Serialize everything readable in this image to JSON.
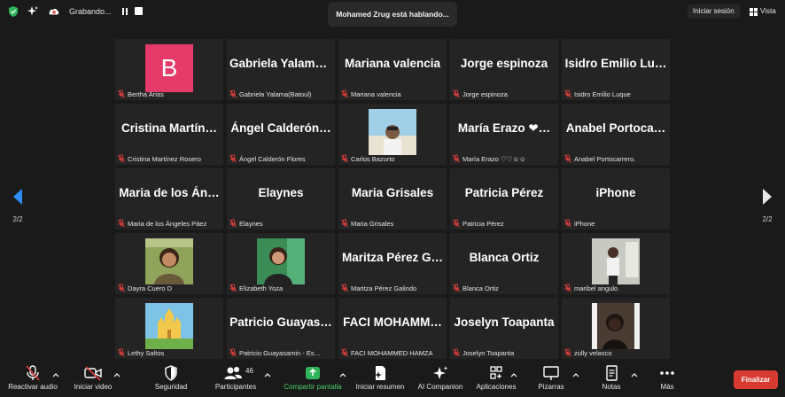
{
  "topbar": {
    "recording_label": "Grabando...",
    "speaker_banner": "Mohamed Zrug está hablando...",
    "signin_label": "Iniciar sesión",
    "view_label": "Vista"
  },
  "nav": {
    "left_page": "2/2",
    "right_page": "2/2"
  },
  "tiles": [
    {
      "big": "",
      "name": "Bertha Arias",
      "kind": "avatar",
      "initial": "B"
    },
    {
      "big": "Gabriela  Yalama…",
      "name": "Gabriela Yalama(Batoul)",
      "kind": "text"
    },
    {
      "big": "Mariana valencia",
      "name": "Mariana valencia",
      "kind": "text"
    },
    {
      "big": "Jorge espinoza",
      "name": "Jorge espinoza",
      "kind": "text"
    },
    {
      "big": "Isidro  Emilio  Lu…",
      "name": "Isidro Emilio Luque",
      "kind": "text"
    },
    {
      "big": "Cristina  Martín…",
      "name": "Cristina Martínez Rosero",
      "kind": "text"
    },
    {
      "big": "Ángel  Calderón…",
      "name": "Ángel Calderón Flores",
      "kind": "text"
    },
    {
      "big": "",
      "name": "Carlos Bazurto",
      "kind": "photo-beach"
    },
    {
      "big": "María  Erazo  ❤…",
      "name": "María Erazo ♡♡☺☺",
      "kind": "text"
    },
    {
      "big": "Anabel  Portoca…",
      "name": "Anabel Portocarrero.",
      "kind": "text"
    },
    {
      "big": "Maria  de  los  Án…",
      "name": "Maria de los Ángeles Páez",
      "kind": "text"
    },
    {
      "big": "Elaynes",
      "name": "Elaynes",
      "kind": "text"
    },
    {
      "big": "Maria Grisales",
      "name": "Maria Grisales",
      "kind": "text"
    },
    {
      "big": "Patricia Pérez",
      "name": "Patricia Pérez",
      "kind": "text"
    },
    {
      "big": "iPhone",
      "name": "iPhone",
      "kind": "text"
    },
    {
      "big": "",
      "name": "Dayra Cuero D",
      "kind": "photo-portrait"
    },
    {
      "big": "",
      "name": "Elizabeth Yoza",
      "kind": "photo-green"
    },
    {
      "big": "Maritza  Pérez  G…",
      "name": "Maritza Pérez Galindo",
      "kind": "text"
    },
    {
      "big": "Blanca Ortiz",
      "name": "Blanca Ortiz",
      "kind": "text"
    },
    {
      "big": "",
      "name": "maribel angulo",
      "kind": "photo-gray"
    },
    {
      "big": "",
      "name": "Lethy Saltos",
      "kind": "photo-castle"
    },
    {
      "big": "Patricio  Guayas…",
      "name": "Patricio Guayasamin - Es…",
      "kind": "text"
    },
    {
      "big": "FACI  MOHAMM…",
      "name": "FACI MOHAMMED HAMZA",
      "kind": "text"
    },
    {
      "big": "Joselyn Toapanta",
      "name": "Joselyn Toapanta",
      "kind": "text"
    },
    {
      "big": "",
      "name": "zully velasco",
      "kind": "photo-dark"
    }
  ],
  "toolbar": {
    "unmute": "Reactivar audio",
    "video": "Iniciar video",
    "security": "Seguridad",
    "participants": "Participantes",
    "participants_count": "46",
    "share": "Compartir pantalla",
    "summary": "Iniciar resumen",
    "companion": "AI Companion",
    "apps": "Aplicaciones",
    "whiteboards": "Pizarras",
    "notes": "Notas",
    "more": "Más",
    "end": "Finalizar"
  },
  "colors": {
    "accent_share": "#4ad06a",
    "end": "#d73a2f",
    "avatar_b": "#e53a6a",
    "muted": "#e0403a"
  }
}
